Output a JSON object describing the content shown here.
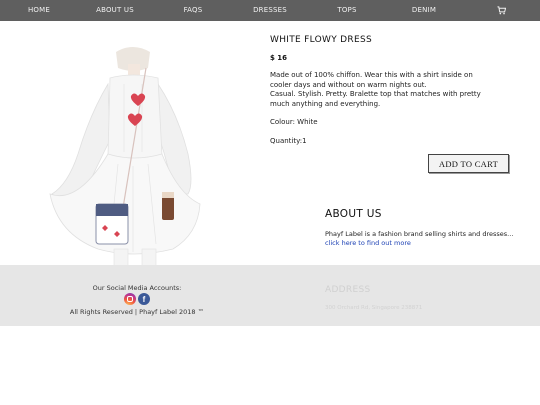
{
  "nav": {
    "items": [
      "HOME",
      "ABOUT US",
      "FAQS",
      "DRESSES",
      "TOPS",
      "DENIM"
    ],
    "cart_icon": "shopping-cart-icon"
  },
  "product": {
    "title": "WHITE FLOWY DRESS",
    "price": "$ 16",
    "description": [
      "Made out of 100% chiffon. Wear this with a shirt inside on cooler days and without on warm nights out.",
      "Casual. Stylish. Pretty. Bralette top that matches with pretty much anything and everything."
    ],
    "colour": "Colour: White",
    "quantity": "Quantity:1",
    "add_to_cart": "ADD TO CART"
  },
  "about": {
    "heading": "ABOUT US",
    "text": "Phayf Label is a fashion brand selling shirts and dresses...",
    "link": "click here to find out more"
  },
  "footer": {
    "social_label": "Our Social Media Accounts:",
    "rights": "All Rights Reserved | Phayf Label 2018 ™",
    "address_heading": "ADDRESS",
    "address_text": "300 Orchard Rd, Singapore 238871",
    "icons": [
      "instagram-icon",
      "facebook-icon"
    ]
  },
  "colors": {
    "nav_bg": "#5f5f5f",
    "footer_bg": "#e6e6e6",
    "link": "#1a3fb3"
  }
}
